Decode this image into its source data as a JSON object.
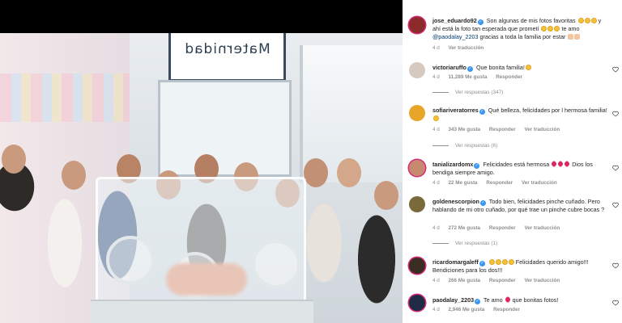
{
  "photo": {
    "sign_text": "Maternidad",
    "alt": "Family photo"
  },
  "comments": [
    {
      "username": "jose_eduardo92",
      "verified": true,
      "text": "Son algunas de mis fotos favoritas",
      "text2": "y ahí está la foto tan esperada que prometí",
      "text3": "te amo",
      "mention": "@paodalay_2203",
      "text4": "gracias a toda la familia por estar",
      "time": "4 d",
      "likes": "",
      "reply_label": "",
      "translate_label": "Ver traducción"
    },
    {
      "username": "victoriaruffo",
      "verified": true,
      "text": "Que bonita familia!",
      "time": "4 d",
      "likes": "11,289 Me gusta",
      "reply_label": "Responder",
      "translate_label": "",
      "view_replies": "Ver respuestas (347)"
    },
    {
      "username": "sofiariveratorres",
      "verified": true,
      "text": "Qué belleza, felicidades por l hermosa familia!",
      "time": "4 d",
      "likes": "343 Me gusta",
      "reply_label": "Responder",
      "translate_label": "Ver traducción",
      "view_replies": "Ver respuestas (6)"
    },
    {
      "username": "tanializardomx",
      "verified": true,
      "text": "Felicidades está hermosa",
      "text2": "Dios los bendiga siempre amigo.",
      "time": "4 d",
      "likes": "22 Me gusta",
      "reply_label": "Responder",
      "translate_label": "Ver traducción"
    },
    {
      "username": "goldenescorpion",
      "verified": true,
      "text": "Todo bien, felicidades pinche cuñado. Pero hablando de mi otro cuñado, por qué trae un pinche cubre bocas ?",
      "time": "4 d",
      "likes": "272 Me gusta",
      "reply_label": "Responder",
      "translate_label": "Ver traducción",
      "view_replies": "Ver respuestas (1)"
    },
    {
      "username": "ricardomargaleff",
      "verified": true,
      "text": "Felicidades querido amigo!!! Bendiciones para los dos!!!",
      "time": "4 d",
      "likes": "266 Me gusta",
      "reply_label": "Responder",
      "translate_label": "Ver traducción"
    },
    {
      "username": "paodalay_2203",
      "verified": true,
      "text": "Te amo",
      "text2": "que bonitas fotos!",
      "time": "4 d",
      "likes": "2,946 Me gusta",
      "reply_label": "Responder",
      "translate_label": ""
    }
  ],
  "colors": {
    "verified": "#3897f0",
    "meta_text": "#8e8e8e",
    "mention": "#00376b",
    "story_ring": "#d62976"
  },
  "icons": [
    "heart-outline-icon",
    "verified-badge-icon"
  ]
}
